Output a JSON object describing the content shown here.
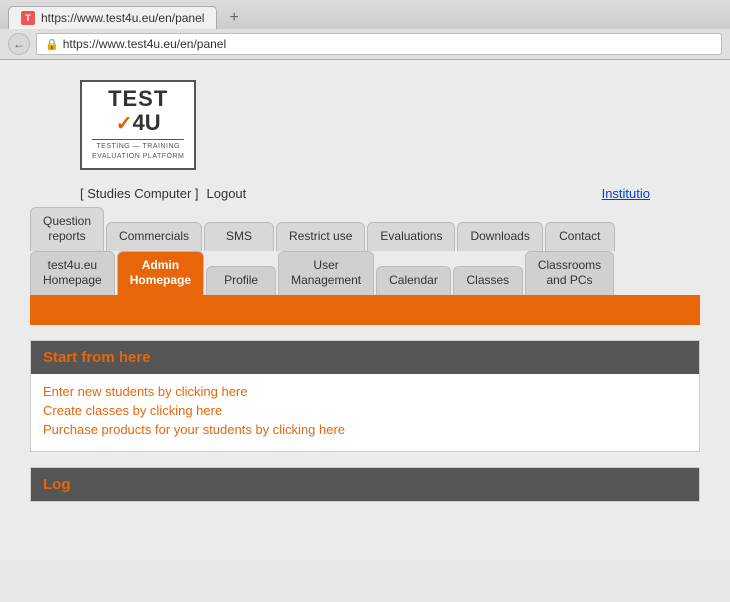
{
  "browser": {
    "tab_title": "https://www.test4u.eu/en/panel",
    "tab_icon": "T",
    "plus_label": "+",
    "back_icon": "←",
    "url": "https://www.test4u.eu/en/panel",
    "lock_icon": "🔒"
  },
  "logo": {
    "test": "TEST",
    "check": "✓",
    "number": "4",
    "u": "U",
    "line1": "TESTING — TRAINING",
    "line2": "EVALUATION PLATFORM"
  },
  "user_nav": {
    "studies": "[ Studies Computer ]",
    "logout": "Logout",
    "institution": "Institutio"
  },
  "nav_row1": [
    {
      "label": "Question\nreports",
      "active": false
    },
    {
      "label": "Commercials",
      "active": false
    },
    {
      "label": "SMS",
      "active": false
    },
    {
      "label": "Restrict use",
      "active": false
    },
    {
      "label": "Evaluations",
      "active": false
    },
    {
      "label": "Downloads",
      "active": false
    },
    {
      "label": "Contact",
      "active": false
    }
  ],
  "nav_row2": [
    {
      "label": "test4u.eu\nHomepage",
      "active": false
    },
    {
      "label": "Admin\nHomepage",
      "active": true
    },
    {
      "label": "Profile",
      "active": false
    },
    {
      "label": "User\nManagement",
      "active": false
    },
    {
      "label": "Calendar",
      "active": false
    },
    {
      "label": "Classes",
      "active": false
    },
    {
      "label": "Classrooms\nand PCs",
      "active": false
    }
  ],
  "start_section": {
    "title": "Start from here",
    "links": [
      "Enter new students by clicking here",
      "Create classes by clicking here",
      "Purchase products for your students by clicking here"
    ]
  },
  "log_section": {
    "title": "Log"
  }
}
